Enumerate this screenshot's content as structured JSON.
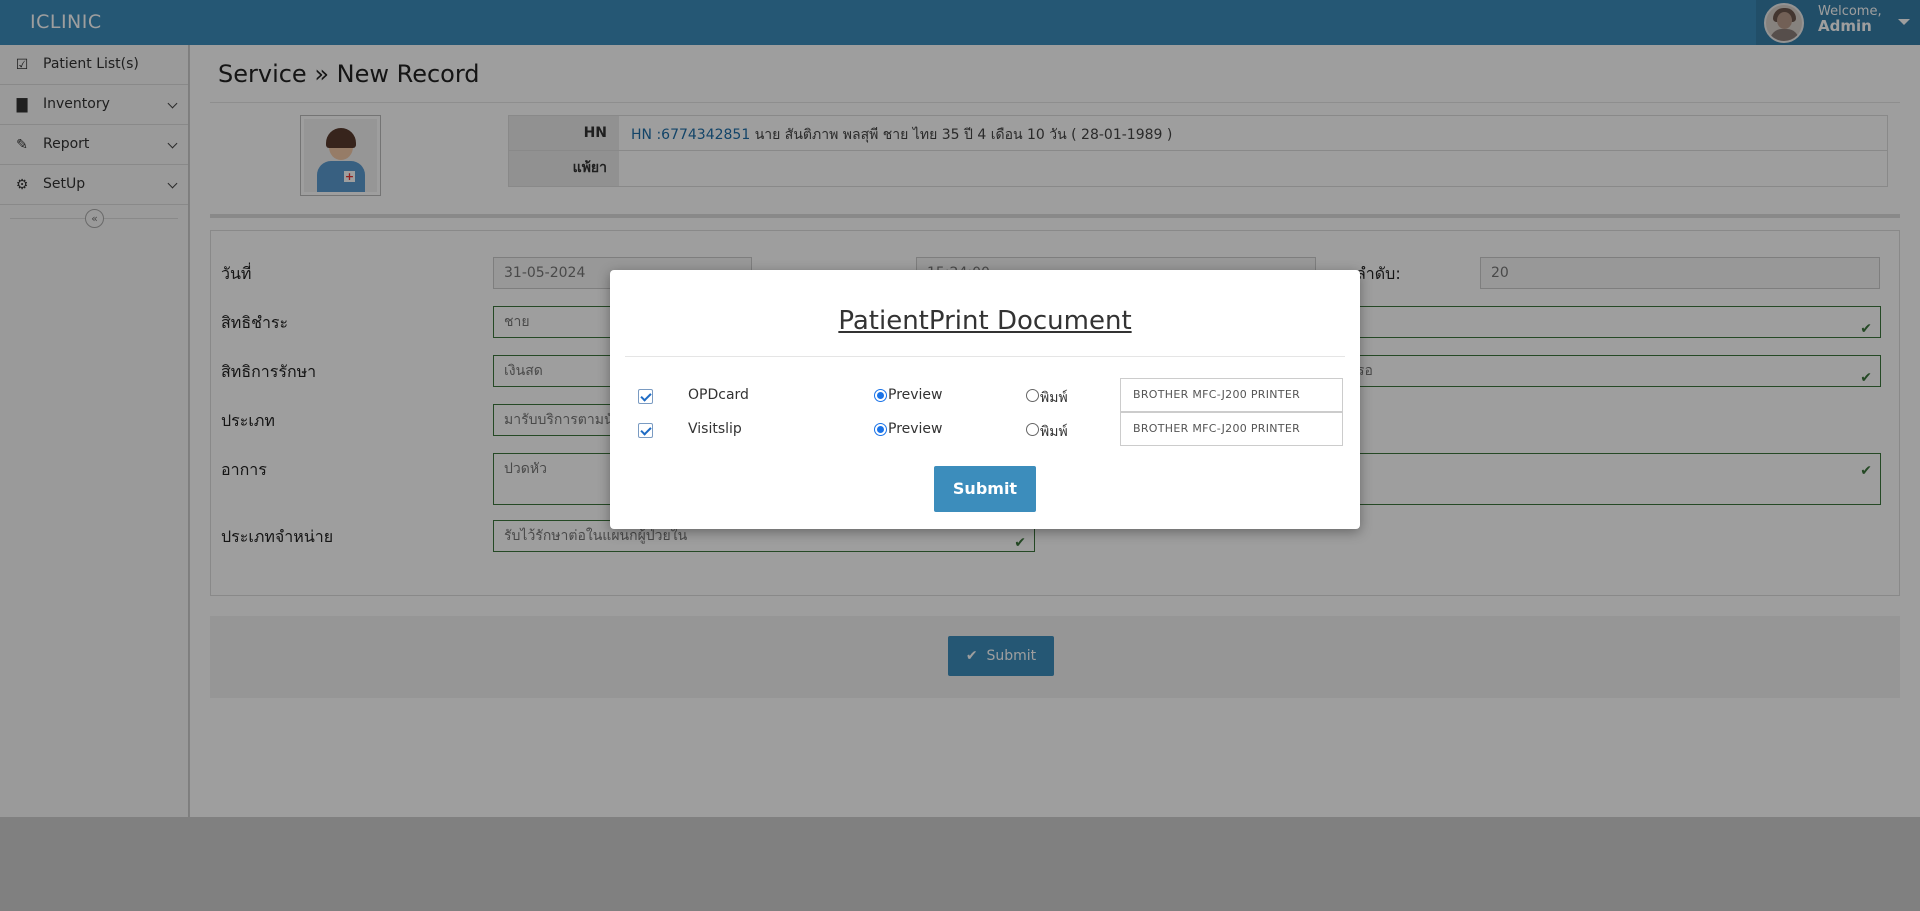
{
  "app": {
    "brand": "ICLINIC"
  },
  "user": {
    "welcome": "Welcome,",
    "name": "Admin"
  },
  "sidebar": {
    "items": [
      {
        "label": "Patient List(s)",
        "icon": "check-square-icon"
      },
      {
        "label": "Inventory",
        "icon": "file-icon"
      },
      {
        "label": "Report",
        "icon": "edit-icon"
      },
      {
        "label": "SetUp",
        "icon": "gear-icon"
      }
    ],
    "collapse_glyph": "«"
  },
  "page": {
    "title": "Service » New Record"
  },
  "patient": {
    "hn_label": "HN",
    "hn_number": "HN :6774342851",
    "hn_details": "นาย  สันติภาพ  พลสุพี     ชาย  ไทย  35 ปี 4 เดือน 10 วัน (  28-01-1989  )",
    "allergy_label": "แพ้ยา",
    "allergy_value": ""
  },
  "form": {
    "date_label": "วันที่",
    "date_value": "31-05-2024",
    "time_value": "15:24:00",
    "order_label": "ลำดับ:",
    "order_value": "20",
    "payer_label": "สิทธิชำระ",
    "payer_value": "ชาย",
    "treatment_label": "สิทธิการรักษา",
    "treatment_value": "เงินสด",
    "treatment_right_value": "รอ",
    "type_label": "ประเภท",
    "type_value": "มารับบริการตามนัด",
    "symptom_label": "อาการ",
    "symptom_value": "ปวดหัว",
    "discharge_label": "ประเภทจำหน่าย",
    "discharge_value": "รับไว้รักษาต่อในแผนกผู้ป่วยใน"
  },
  "main_submit": {
    "label": "Submit"
  },
  "modal": {
    "title": "PatientPrint Document",
    "rows": [
      {
        "name": "OPDcard",
        "checked": true,
        "preview_label": "Preview",
        "print_label": "พิมพ์",
        "selected": "Preview",
        "printer": "BROTHER MFC-J200 PRINTER"
      },
      {
        "name": "Visitslip",
        "checked": true,
        "preview_label": "Preview",
        "print_label": "พิมพ์",
        "selected": "Preview",
        "printer": "BROTHER MFC-J200 PRINTER"
      }
    ],
    "submit_label": "Submit"
  },
  "colors": {
    "primary": "#3c8dbc",
    "primary_dark": "#367fa9",
    "success": "#3c763d"
  }
}
